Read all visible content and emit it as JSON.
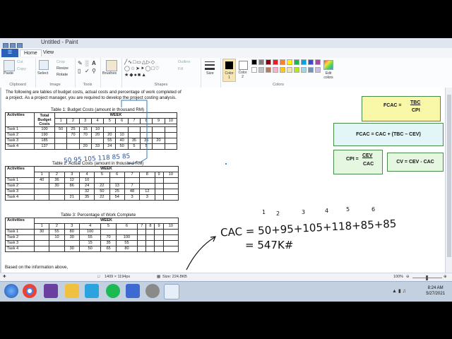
{
  "window": {
    "title": "Untitled - Paint"
  },
  "menu": {
    "file_label": "",
    "tabs": [
      "Home",
      "View"
    ]
  },
  "ribbon": {
    "clipboard": {
      "paste": "Paste",
      "cut": "Cut",
      "copy": "Copy",
      "group": "Clipboard"
    },
    "image": {
      "select": "Select",
      "crop": "Crop",
      "resize": "Resize",
      "rotate": "Rotate",
      "group": "Image"
    },
    "tools": {
      "group": "Tools"
    },
    "brushes": {
      "label": "Brushes"
    },
    "shapes": {
      "outline": "Outline",
      "fill": "Fill",
      "group": "Shapes"
    },
    "size": {
      "label": "Size"
    },
    "colors": {
      "color1": "Color 1",
      "color2": "Color 2",
      "edit": "Edit colors",
      "group": "Colors"
    },
    "palette": [
      "#000000",
      "#7f7f7f",
      "#880015",
      "#ed1c24",
      "#ff7f27",
      "#fff200",
      "#22b14c",
      "#00a2e8",
      "#3f48cc",
      "#a349a4",
      "#ffffff",
      "#c3c3c3",
      "#b97a57",
      "#ffaec9",
      "#ffc90e",
      "#efe4b0",
      "#b5e61d",
      "#99d9ea",
      "#7092be",
      "#c8bfe7"
    ]
  },
  "doc": {
    "intro_line1": "The following are tables of budget costs, actual costs and percentage of work completed of",
    "intro_line2": "a project.  As a project manager, you are required to develop the project costing analysis.",
    "footer": "Based on the information above,",
    "table1": {
      "caption": "Table 1: Budget Costs (amount in thousand RM)",
      "h_activities": "Activities",
      "h_total": "Total Budget Costs",
      "h_week": "WEEK",
      "weeks": [
        "1",
        "2",
        "3",
        "4",
        "5",
        "6",
        "7",
        "8",
        "9",
        "10"
      ],
      "rows": [
        {
          "task": "Task 1",
          "total": "100",
          "cells": [
            "50",
            "25",
            "15",
            "10",
            "",
            "",
            "",
            "",
            "",
            ""
          ]
        },
        {
          "task": "Task 2",
          "total": "190",
          "cells": [
            "",
            "70",
            "70",
            "20",
            "20",
            "10",
            "",
            "",
            "",
            ""
          ]
        },
        {
          "task": "Task 3",
          "total": "185",
          "cells": [
            "",
            "",
            "",
            "",
            "55",
            "40",
            "35",
            "35",
            "20",
            ""
          ]
        },
        {
          "task": "Task 4",
          "total": "137",
          "cells": [
            "",
            "",
            "20",
            "33",
            "24",
            "50",
            "5",
            "5",
            "",
            ""
          ]
        }
      ]
    },
    "table2": {
      "caption": "Table 2: Actual Costs (amount in thousand RM)",
      "h_activities": "Activities",
      "h_week": "WEEK",
      "weeks": [
        "1",
        "2",
        "3",
        "4",
        "5",
        "6",
        "7",
        "8",
        "9",
        "10"
      ],
      "rows": [
        {
          "task": "Task 1",
          "cells": [
            "40",
            "36",
            "12",
            "10",
            "",
            "",
            "",
            "",
            "",
            ""
          ]
        },
        {
          "task": "Task 2",
          "cells": [
            "",
            "30",
            "86",
            "24",
            "22",
            "13",
            "7",
            "",
            "",
            ""
          ]
        },
        {
          "task": "Task 3",
          "cells": [
            "",
            "",
            "",
            "32",
            "50",
            "25",
            "48",
            "12",
            "",
            ""
          ]
        },
        {
          "task": "Task 4",
          "cells": [
            "",
            "",
            "21",
            "35",
            "22",
            "54",
            "3",
            "3",
            "",
            ""
          ]
        }
      ]
    },
    "table3": {
      "caption": "Table 3: Percentage of Work Complete",
      "h_activities": "Activities",
      "h_week": "WEEK",
      "weeks": [
        "1",
        "2",
        "3",
        "4",
        "5",
        "6",
        "7",
        "8",
        "9",
        "10"
      ],
      "rows": [
        {
          "task": "Task 1",
          "cells": [
            "30",
            "55",
            "80",
            "100",
            "",
            "",
            "",
            "",
            "",
            ""
          ]
        },
        {
          "task": "Task 2",
          "cells": [
            "",
            "10",
            "30",
            "55",
            "70",
            "100",
            "",
            "",
            "",
            ""
          ]
        },
        {
          "task": "Task 3",
          "cells": [
            "",
            "",
            "",
            "15",
            "35",
            "55",
            "",
            "",
            "",
            ""
          ]
        },
        {
          "task": "Task 4",
          "cells": [
            "",
            "",
            "30",
            "50",
            "65",
            "80",
            "",
            "",
            "",
            ""
          ]
        }
      ]
    }
  },
  "formulas": {
    "fcac1_lhs": "FCAC =",
    "fcac1_num": "TBC",
    "fcac1_den": "CPI",
    "fcac2": "FCAC  =  CAC + (TBC – CEV)",
    "cpi_lhs": "CPI =",
    "cpi_num": "CEV",
    "cpi_den": "CAC",
    "cv": "CV = CEV - CAC"
  },
  "handwriting": {
    "above_t2": "50 95 105 118 85 85",
    "cac_line": "CAC = 50+95+105+118+85+85",
    "result": "= 547K#",
    "col_nums": [
      "1",
      "2",
      "3",
      "4",
      "5",
      "6"
    ]
  },
  "status": {
    "pixels": "1409 × 1194px",
    "size": "Size: 224.8KB",
    "zoom": "100%"
  },
  "taskbar": {
    "time": "8:24 AM",
    "date": "5/27/2021"
  }
}
